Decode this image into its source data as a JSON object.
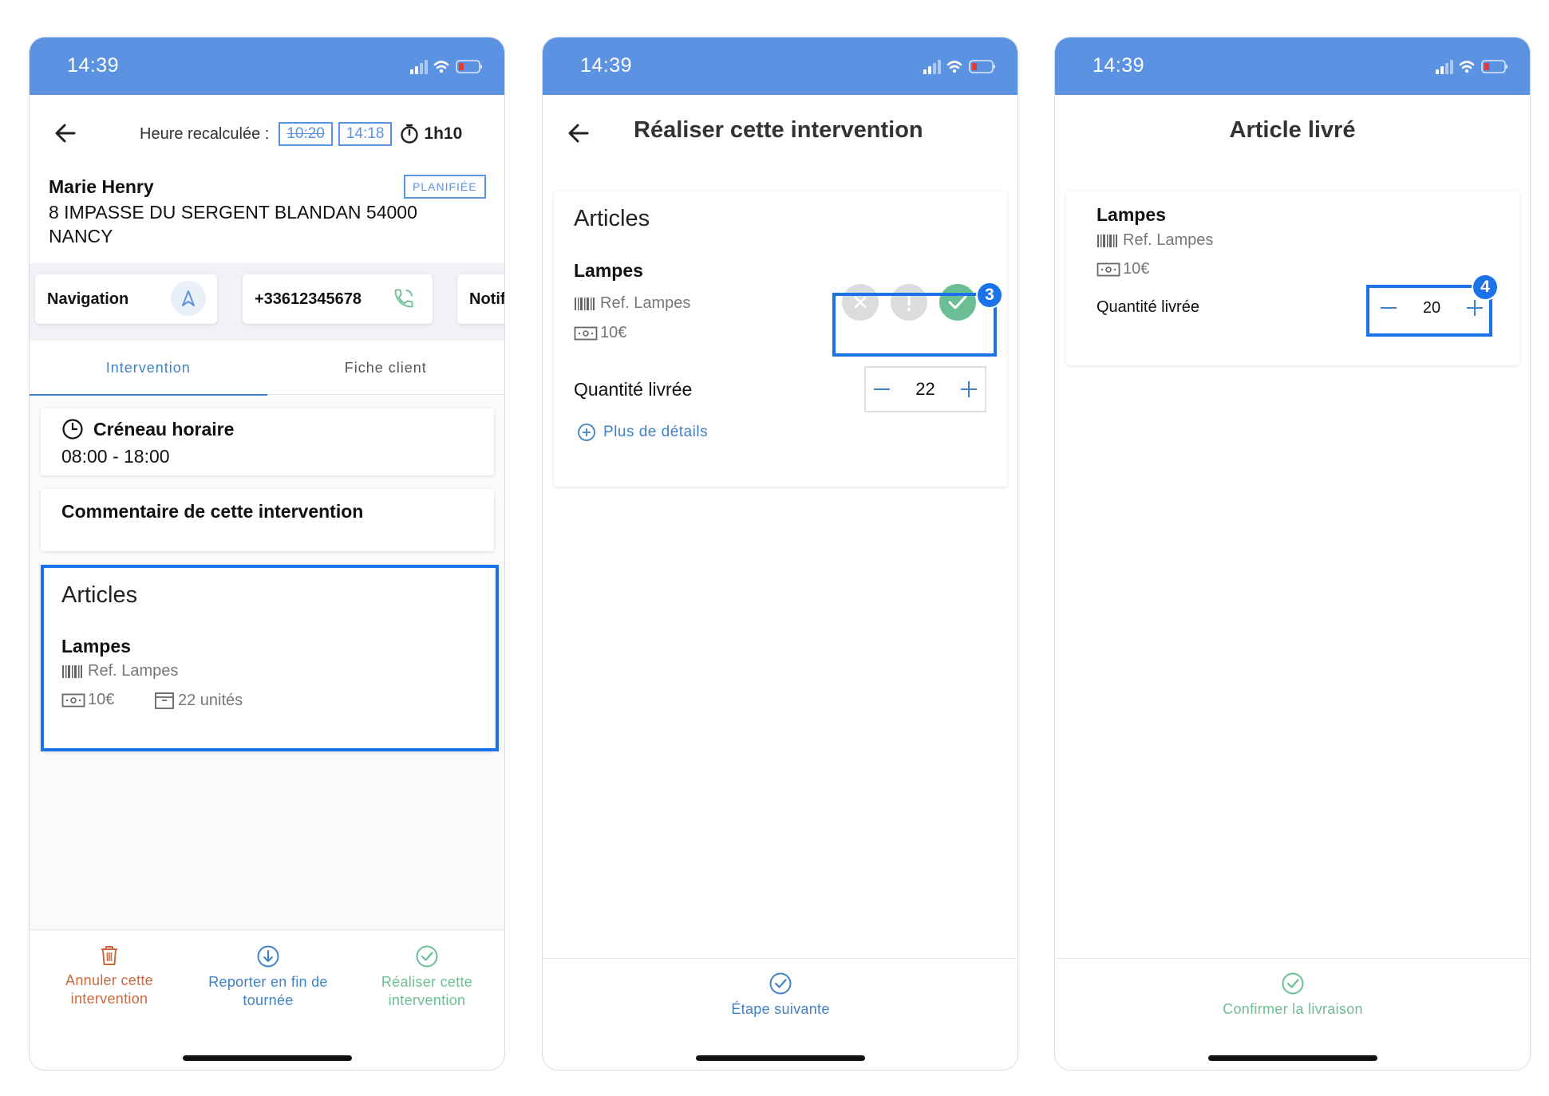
{
  "colors": {
    "accent": "#5b93e2",
    "primary_blue": "#3f82c7",
    "highlight": "#1a73e8",
    "danger": "#c8693f",
    "success": "#6cbf94"
  },
  "status_bar": {
    "time": "14:39"
  },
  "screen1": {
    "recalc_label": "Heure recalculée :",
    "original_time": "10:20",
    "new_time": "14:18",
    "duration": "1h10",
    "client_name": "Marie Henry",
    "client_address": "8 IMPASSE DU SERGENT BLANDAN 54000 NANCY",
    "status_badge": "PLANIFIÉE",
    "actions": {
      "navigation": "Navigation",
      "phone": "+33612345678",
      "notif": "Notif"
    },
    "tabs": [
      {
        "label": "Intervention"
      },
      {
        "label": "Fiche client"
      }
    ],
    "slot_title": "Créneau horaire",
    "slot_value": "08:00 - 18:00",
    "comment_title": "Commentaire de cette intervention",
    "articles_title": "Articles",
    "article": {
      "name": "Lampes",
      "ref": "Ref. Lampes",
      "price": "10€",
      "units": "22 unités"
    },
    "bottom": {
      "cancel": "Annuler cette intervention",
      "postpone": "Reporter en fin de tournée",
      "realize": "Réaliser cette intervention"
    }
  },
  "screen2": {
    "title": "Réaliser cette intervention",
    "articles_title": "Articles",
    "article": {
      "name": "Lampes",
      "ref": "Ref. Lampes",
      "price": "10€"
    },
    "quantity_label": "Quantité livrée",
    "quantity_value": "22",
    "more_details": "Plus de détails",
    "badge": "3",
    "next_step": "Étape suivante"
  },
  "screen3": {
    "title": "Article livré",
    "article": {
      "name": "Lampes",
      "ref": "Ref. Lampes",
      "price": "10€"
    },
    "quantity_label": "Quantité livrée",
    "quantity_value": "20",
    "badge": "4",
    "confirm": "Confirmer la livraison"
  }
}
